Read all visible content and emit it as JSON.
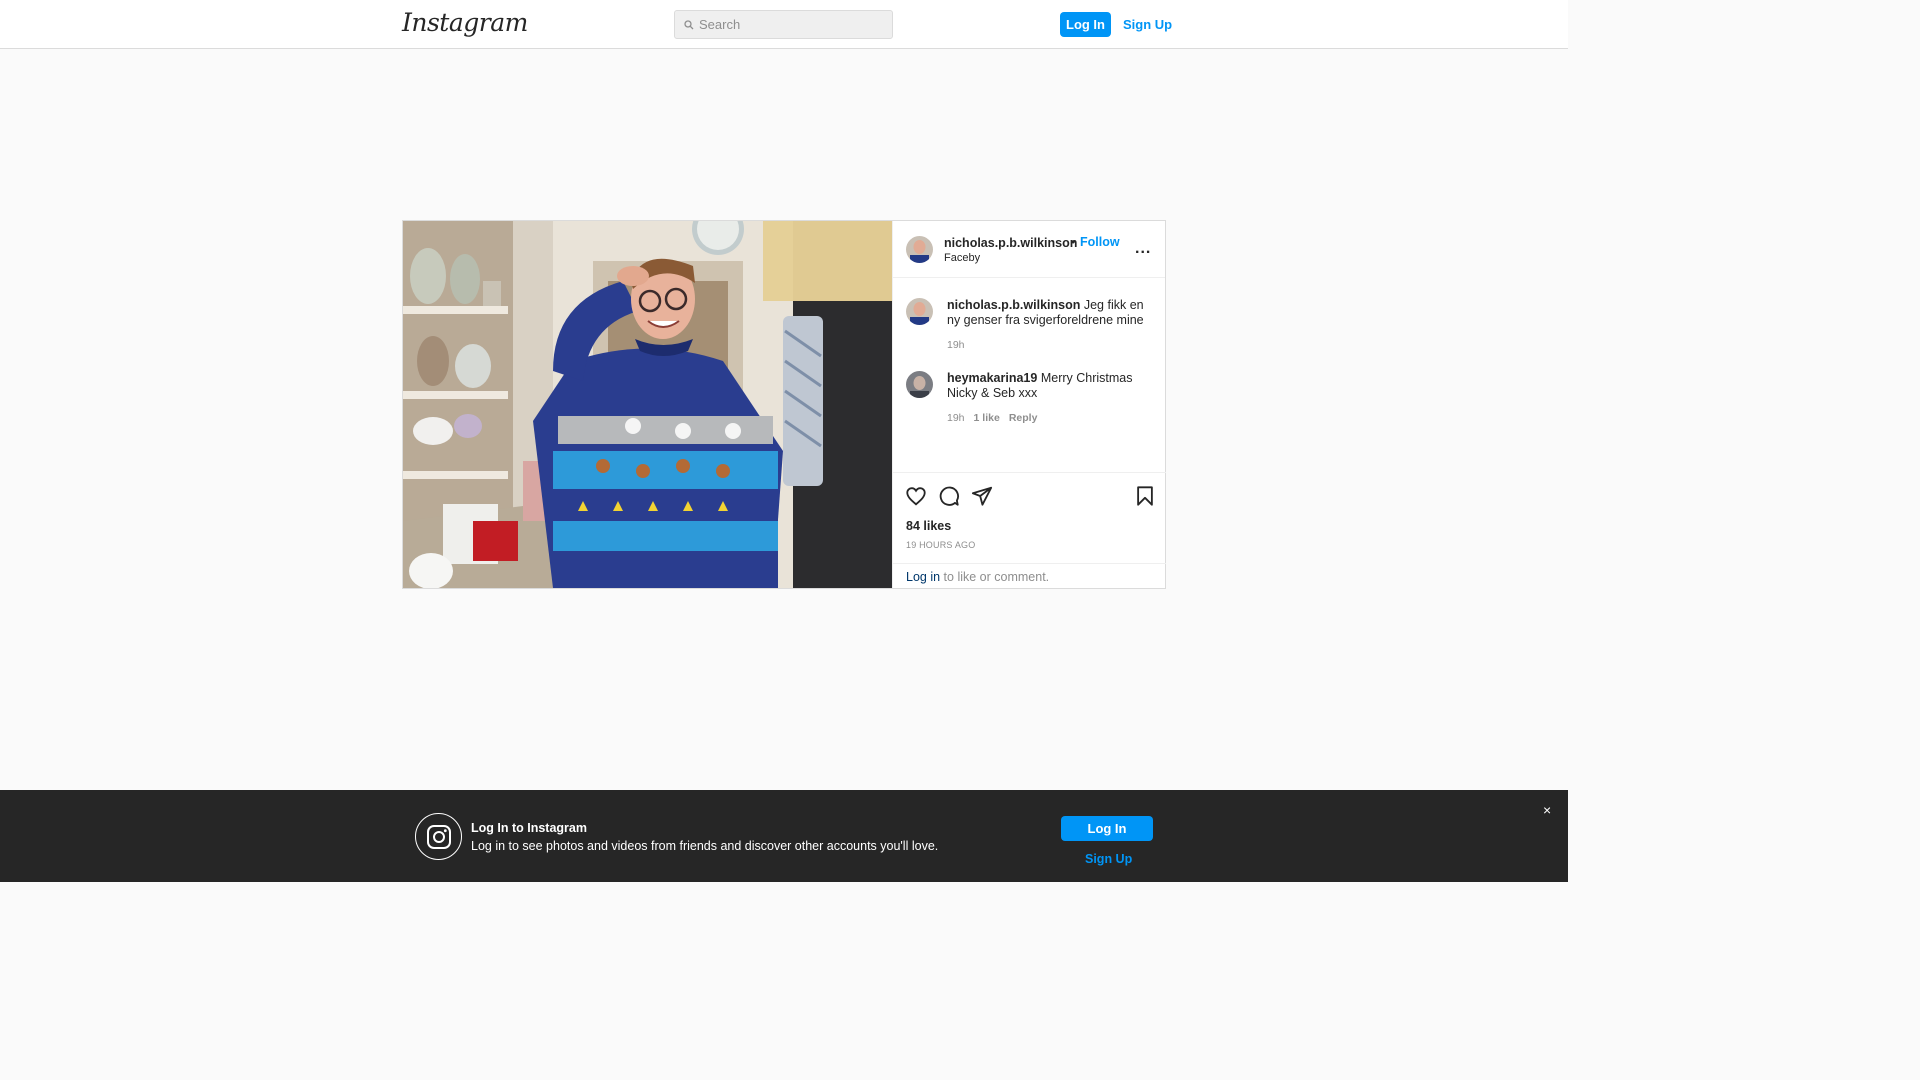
{
  "header": {
    "logo_text": "Instagram",
    "search_placeholder": "Search",
    "login_label": "Log In",
    "signup_label": "Sign Up"
  },
  "post": {
    "username": "nicholas.p.b.wilkinson",
    "separator": "•",
    "follow_label": "Follow",
    "location": "Faceby",
    "more_label": "...",
    "caption": {
      "username": "nicholas.p.b.wilkinson",
      "text": "Jeg fikk en ny genser fra svigerforeldrene mine",
      "time": "19h"
    },
    "comments": [
      {
        "username": "heymakarina19",
        "text": "Merry Christmas Nicky & Seb xxx",
        "time": "19h",
        "likes": "1 like",
        "reply_label": "Reply"
      }
    ],
    "icons": [
      "heart-icon",
      "comment-icon",
      "share-icon",
      "bookmark-icon"
    ],
    "likes": "84 likes",
    "timestamp": "19 HOURS AGO",
    "login_prompt": {
      "link": "Log in",
      "rest": "to like or comment."
    }
  },
  "banner": {
    "title": "Log In to Instagram",
    "subtitle": "Log in to see photos and videos from friends and discover other accounts you'll love.",
    "login_label": "Log In",
    "signup_label": "Sign Up",
    "close_label": "×"
  },
  "colors": {
    "accent": "#0095f6",
    "link_dark": "#00376b",
    "banner_bg": "#262626",
    "border": "#dbdbdb"
  }
}
